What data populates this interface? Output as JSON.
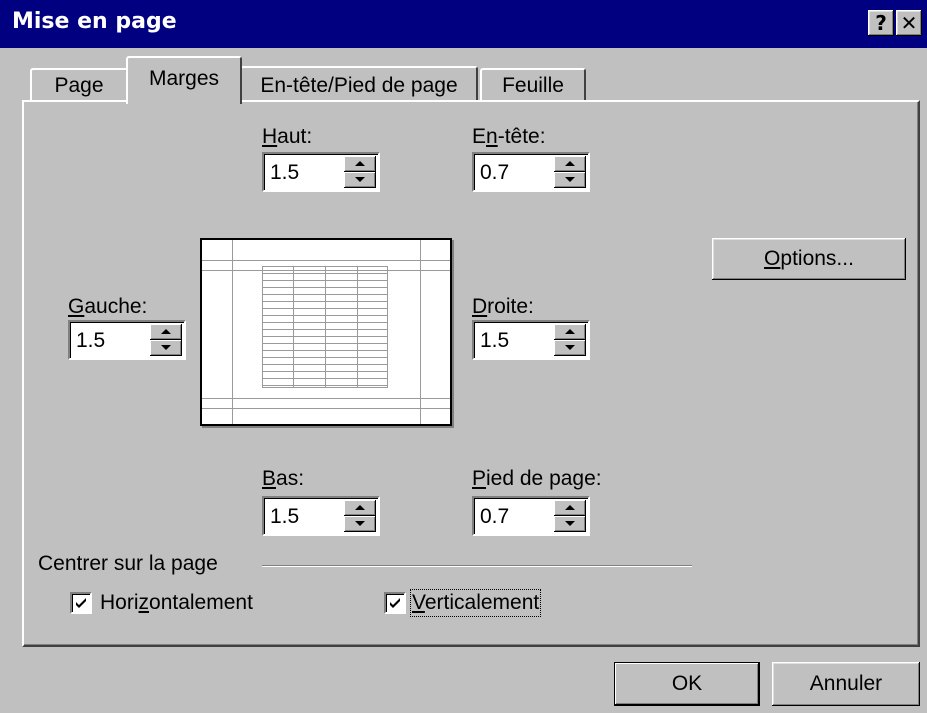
{
  "window": {
    "title": "Mise en page",
    "help_label": "?",
    "close_label": "✕"
  },
  "tabs": [
    {
      "label": "Page",
      "active": false
    },
    {
      "label": "Marges",
      "active": true
    },
    {
      "label": "En-tête/Pied de page",
      "active": false
    },
    {
      "label": "Feuille",
      "active": false
    }
  ],
  "margins": {
    "haut": {
      "label_pre": "",
      "label_ul": "H",
      "label_post": "aut:",
      "value": "1.5"
    },
    "entete": {
      "label_pre": "E",
      "label_ul": "n",
      "label_post": "-tête:",
      "value": "0.7"
    },
    "gauche": {
      "label_pre": "",
      "label_ul": "G",
      "label_post": "auche:",
      "value": "1.5"
    },
    "droite": {
      "label_pre": "",
      "label_ul": "D",
      "label_post": "roite:",
      "value": "1.5"
    },
    "bas": {
      "label_pre": "",
      "label_ul": "B",
      "label_post": "as:",
      "value": "1.5"
    },
    "pied": {
      "label_pre": "",
      "label_ul": "P",
      "label_post": "ied de page:",
      "value": "0.7"
    }
  },
  "options_button": {
    "label_ul": "O",
    "label_post": "ptions..."
  },
  "center": {
    "group_label": "Centrer sur la page",
    "horizontal": {
      "label_pre": "Hori",
      "label_ul": "z",
      "label_post": "ontalement",
      "checked": true
    },
    "vertical": {
      "label_pre": "",
      "label_ul": "V",
      "label_post": "erticalement",
      "checked": true
    }
  },
  "footer": {
    "ok_label": "OK",
    "cancel_label": "Annuler"
  },
  "icons": {
    "help": "help-icon",
    "close": "close-icon",
    "spin_up": "arrow-up-icon",
    "spin_down": "arrow-down-icon",
    "check": "checkmark-icon"
  }
}
